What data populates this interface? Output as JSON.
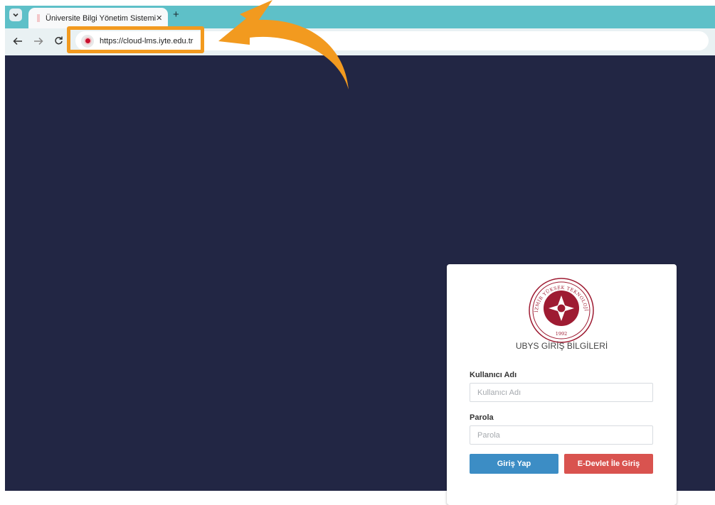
{
  "browser": {
    "tab_title": "Üniversite Bilgi Yönetim Sistemi",
    "tab_close": "✕",
    "new_tab": "+",
    "url": "https://cloud-lms.iyte.edu.tr",
    "highlight_color": "#f29a1f",
    "nav_icons": [
      "arrow-left-icon",
      "arrow-right-icon",
      "reload-icon"
    ]
  },
  "login": {
    "title": "UBYS GİRİŞ BİLGİLERİ",
    "username_label": "Kullanıcı Adı",
    "username_placeholder": "Kullanıcı Adı",
    "username_value": "",
    "password_label": "Parola",
    "password_placeholder": "Parola",
    "password_value": "",
    "login_button": "Giriş Yap",
    "edevlet_button": "E-Devlet İle Giriş",
    "logo_text": "İZMİR YÜKSEK TEKNOLOJİ ENSTİTÜSÜ",
    "logo_year": "1992"
  },
  "colors": {
    "page_background": "#222644",
    "login_button": "#3c8dc5",
    "edevlet_button": "#d9534f",
    "tab_strip": "#5ec0c8",
    "seal_red": "#9e1b32"
  }
}
